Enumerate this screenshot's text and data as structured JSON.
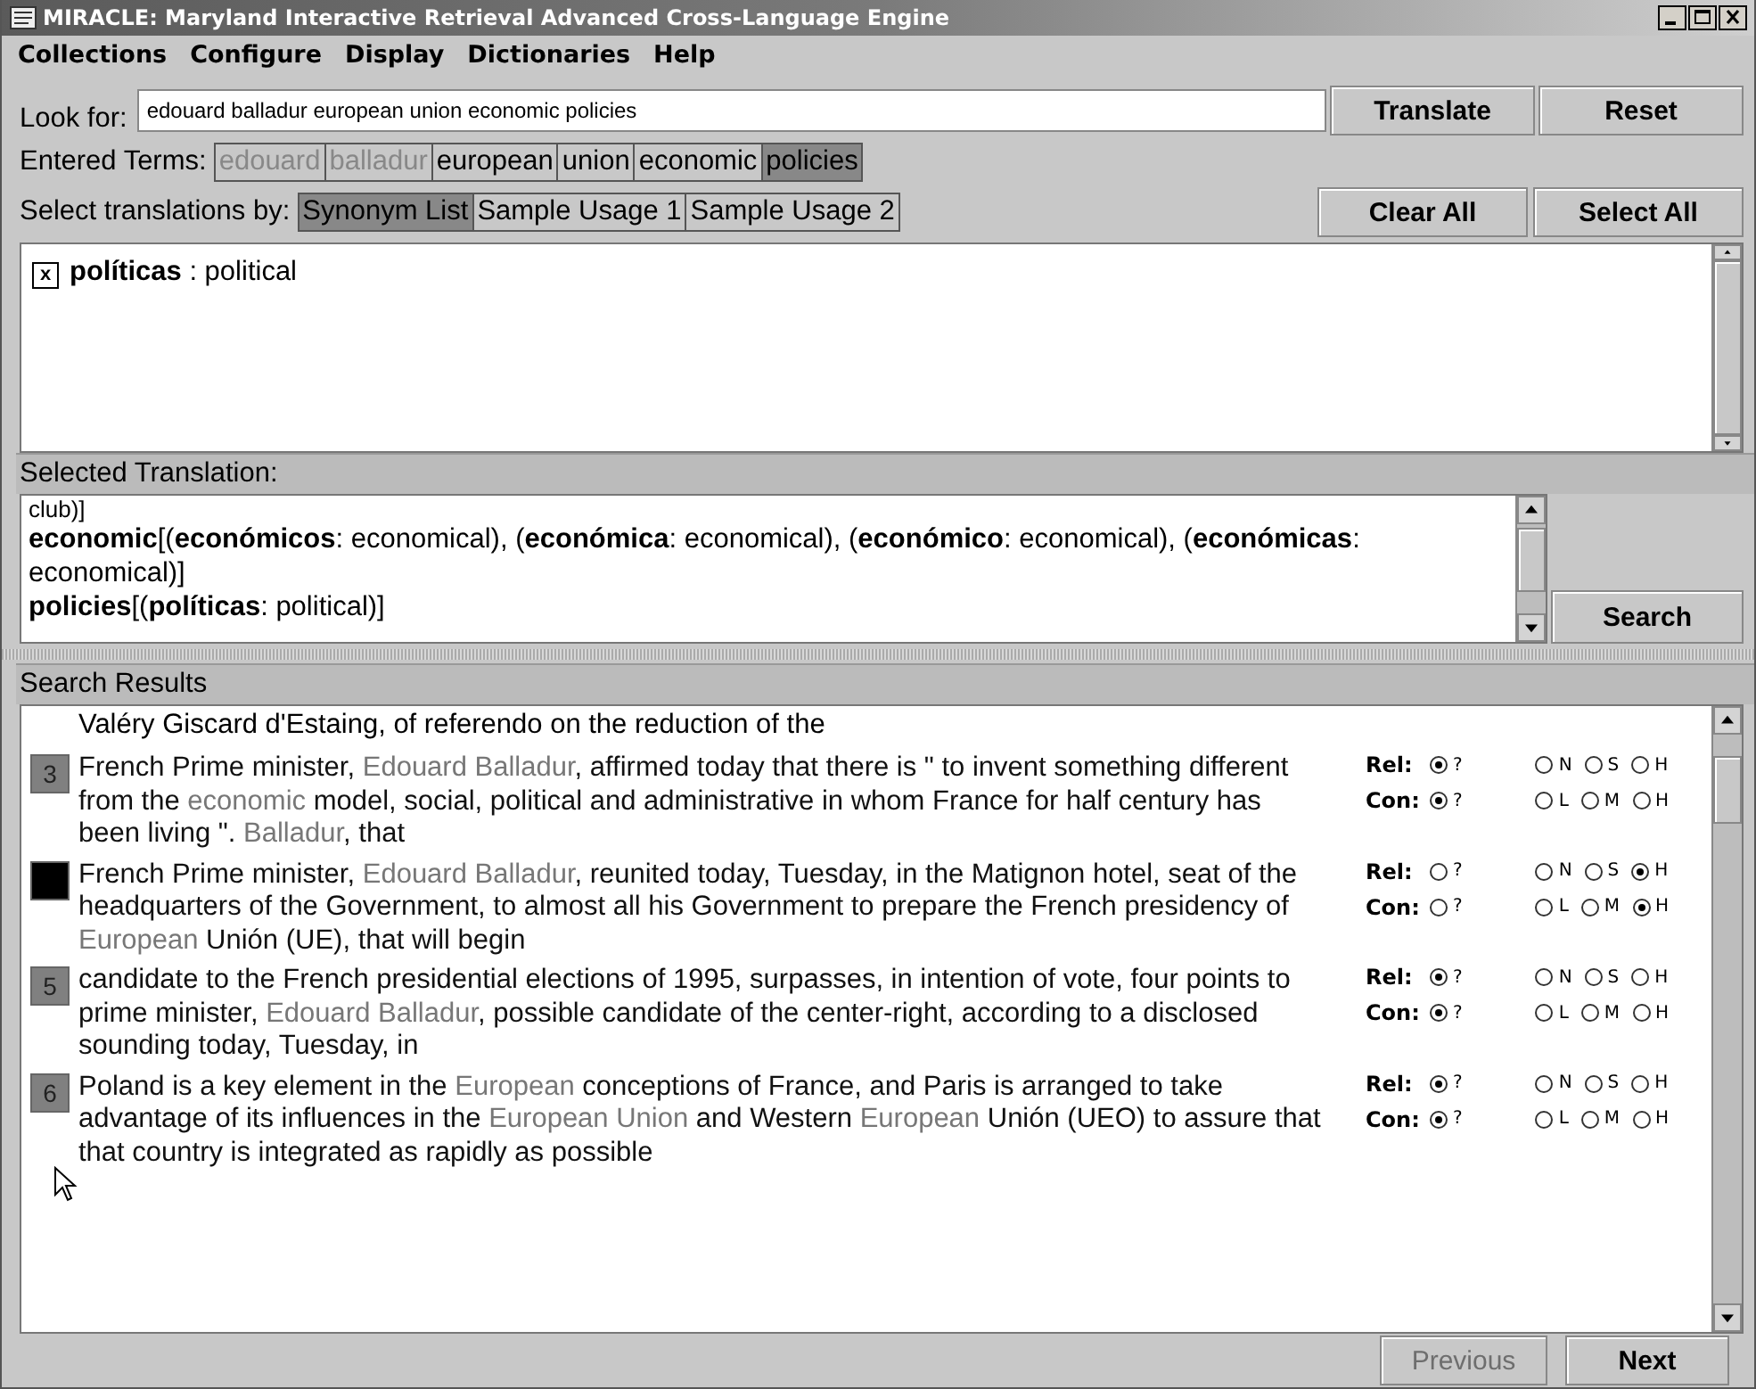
{
  "window": {
    "title": "MIRACLE: Maryland Interactive Retrieval Advanced Cross-Language Engine"
  },
  "menu": [
    "Collections",
    "Configure",
    "Display",
    "Dictionaries",
    "Help"
  ],
  "look_for": {
    "label": "Look for:",
    "value": "edouard balladur european union economic policies",
    "buttons": [
      "Translate",
      "Reset"
    ]
  },
  "entered_terms": {
    "label": "Entered Terms:",
    "terms": [
      {
        "label": "edouard",
        "disabled": true,
        "selected": false
      },
      {
        "label": "balladur",
        "disabled": true,
        "selected": false
      },
      {
        "label": "european",
        "disabled": false,
        "selected": false
      },
      {
        "label": "union",
        "disabled": false,
        "selected": false
      },
      {
        "label": "economic",
        "disabled": false,
        "selected": false
      },
      {
        "label": "policies",
        "disabled": false,
        "selected": true
      }
    ]
  },
  "select_by": {
    "label": "Select translations by:",
    "tabs": [
      {
        "label": "Synonym List",
        "selected": true
      },
      {
        "label": "Sample Usage 1",
        "selected": false
      },
      {
        "label": "Sample Usage 2",
        "selected": false
      }
    ],
    "buttons": [
      "Clear All",
      "Select All"
    ]
  },
  "translations": [
    {
      "word": "políticas",
      "gloss": " : political",
      "checked": true,
      "mark": "x"
    }
  ],
  "selected_translation": {
    "label": "Selected Translation:",
    "lines": [
      "club)]",
      "**economic**[(**económicos**: economical), (**económica**: economical), (**económico**: economical), (**económicas**: economical)]",
      "**policies**[(**políticas**: political)]"
    ],
    "button": "Search"
  },
  "search_results": {
    "label": "Search Results",
    "partial_line": "Valéry Giscard d'Estaing, of referendo on the reduction of the",
    "results": [
      {
        "number": "3",
        "color": "#808080",
        "segments": [
          {
            "text": "French Prime minister, ",
            "hit": false
          },
          {
            "text": "Edouard Balladur",
            "hit": true
          },
          {
            "text": ", affirmed today that there is \" to invent something different from the ",
            "hit": false
          },
          {
            "text": "economic",
            "hit": true
          },
          {
            "text": " model, social, political and administrative in whom France for half century has been living \". ",
            "hit": false
          },
          {
            "text": "Balladur",
            "hit": true
          },
          {
            "text": ", that",
            "hit": false
          }
        ],
        "groups": [
          {
            "label": "Rel:",
            "options": [
              {
                "label": "?",
                "selected": true
              },
              {
                "label": "N",
                "selected": false
              },
              {
                "label": "S",
                "selected": false
              },
              {
                "label": "H",
                "selected": false
              }
            ]
          },
          {
            "label": "Con:",
            "options": [
              {
                "label": "?",
                "selected": true
              },
              {
                "label": "L",
                "selected": false
              },
              {
                "label": "M",
                "selected": false
              },
              {
                "label": "H",
                "selected": false
              }
            ]
          }
        ]
      },
      {
        "color": "#000000",
        "segments": [
          {
            "text": "French Prime minister, ",
            "hit": false
          },
          {
            "text": "Edouard Balladur",
            "hit": true
          },
          {
            "text": ", reunited today, Tuesday, in the Matignon hotel, seat of the headquarters of the Government, to almost all his Government to prepare the French presidency of ",
            "hit": false
          },
          {
            "text": "European",
            "hit": true
          },
          {
            "text": " Unión (UE), that will begin",
            "hit": false
          }
        ],
        "groups": [
          {
            "label": "Rel:",
            "options": [
              {
                "label": "?",
                "selected": false
              },
              {
                "label": "N",
                "selected": false
              },
              {
                "label": "S",
                "selected": false
              },
              {
                "label": "H",
                "selected": true
              }
            ]
          },
          {
            "label": "Con:",
            "options": [
              {
                "label": "?",
                "selected": false
              },
              {
                "label": "L",
                "selected": false
              },
              {
                "label": "M",
                "selected": false
              },
              {
                "label": "H",
                "selected": true
              }
            ]
          }
        ]
      },
      {
        "number": "5",
        "color": "#808080",
        "segments": [
          {
            "text": "candidate to the French presidential elections of 1995, surpasses, in intention of vote, four points to prime minister, ",
            "hit": false
          },
          {
            "text": "Edouard Balladur",
            "hit": true
          },
          {
            "text": ", possible candidate of the center-right, according to a disclosed sounding today, Tuesday, in",
            "hit": false
          }
        ],
        "groups": [
          {
            "label": "Rel:",
            "options": [
              {
                "label": "?",
                "selected": true
              },
              {
                "label": "N",
                "selected": false
              },
              {
                "label": "S",
                "selected": false
              },
              {
                "label": "H",
                "selected": false
              }
            ]
          },
          {
            "label": "Con:",
            "options": [
              {
                "label": "?",
                "selected": true
              },
              {
                "label": "L",
                "selected": false
              },
              {
                "label": "M",
                "selected": false
              },
              {
                "label": "H",
                "selected": false
              }
            ]
          }
        ]
      },
      {
        "number": "6",
        "color": "#808080",
        "segments": [
          {
            "text": "Poland is a key element in the ",
            "hit": false
          },
          {
            "text": "European",
            "hit": true
          },
          {
            "text": " conceptions of France, and Paris is arranged to take advantage of its influences in the ",
            "hit": false
          },
          {
            "text": "European Union",
            "hit": true
          },
          {
            "text": " and Western ",
            "hit": false
          },
          {
            "text": "European",
            "hit": true
          },
          {
            "text": " Unión (UEO) to assure that that country is integrated as rapidly as possible",
            "hit": false
          }
        ],
        "groups": [
          {
            "label": "Rel:",
            "options": [
              {
                "label": "?",
                "selected": true
              },
              {
                "label": "N",
                "selected": false
              },
              {
                "label": "S",
                "selected": false
              },
              {
                "label": "H",
                "selected": false
              }
            ]
          },
          {
            "label": "Con:",
            "options": [
              {
                "label": "?",
                "selected": true
              },
              {
                "label": "L",
                "selected": false
              },
              {
                "label": "M",
                "selected": false
              },
              {
                "label": "H",
                "selected": false
              }
            ]
          }
        ]
      }
    ]
  },
  "footer": {
    "buttons": [
      {
        "label": "Previous",
        "disabled": true
      },
      {
        "label": "Next",
        "disabled": false
      }
    ]
  }
}
